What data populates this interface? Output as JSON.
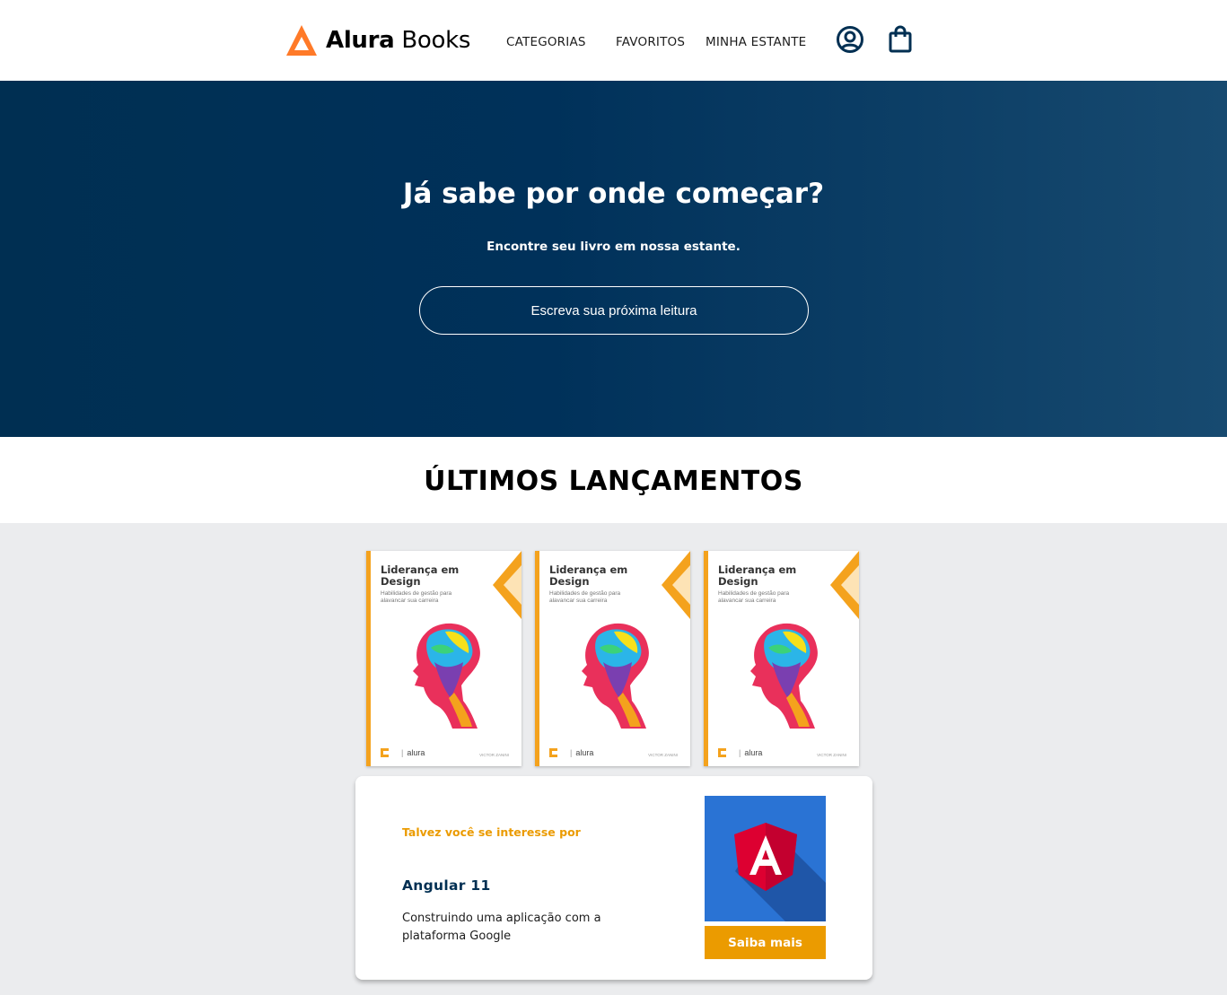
{
  "header": {
    "logo": {
      "brand_bold": "Alura",
      "brand_light": "Books",
      "icon": "alura-triangle-icon",
      "color": "#ff7a28"
    },
    "nav": [
      {
        "label": "CATEGORIAS"
      },
      {
        "label": "FAVORITOS"
      },
      {
        "label": "MINHA ESTANTE"
      }
    ],
    "icons": {
      "profile": "user-circle-icon",
      "bag": "shopping-bag-icon"
    }
  },
  "hero": {
    "title": "Já sabe por onde começar?",
    "subtitle": "Encontre seu livro em nossa estante.",
    "search_placeholder": "Escreva sua próxima leitura",
    "background": [
      "#002f52",
      "#174a70"
    ]
  },
  "releases": {
    "title": "ÚLTIMOS LANÇAMENTOS",
    "books": [
      {
        "title": "Liderança em Design",
        "subtitle": "Habilidades de gestão para alavancar sua carreira",
        "publisher": "alura",
        "author": "VICTOR ZANINI"
      },
      {
        "title": "Liderança em Design",
        "subtitle": "Habilidades de gestão para alavancar sua carreira",
        "publisher": "alura",
        "author": "VICTOR ZANINI"
      },
      {
        "title": "Liderança em Design",
        "subtitle": "Habilidades de gestão para alavancar sua carreira",
        "publisher": "alura",
        "author": "VICTOR ZANINI"
      }
    ]
  },
  "recommendation": {
    "eyebrow": "Talvez você se interesse por",
    "title": "Angular 11",
    "description": "Construindo uma aplicação com a plataforma Google",
    "button_label": "Saiba mais",
    "cover_icon": "angular-logo-icon",
    "accent": "#eb9b00"
  }
}
